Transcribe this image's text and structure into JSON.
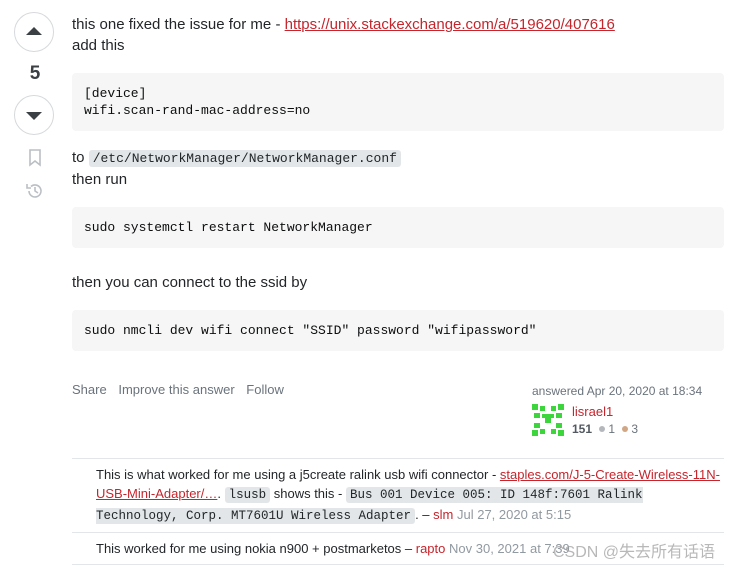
{
  "vote": {
    "score": "5"
  },
  "post": {
    "line1_text": "this one fixed the issue for me - ",
    "line1_link": "https://unix.stackexchange.com/a/519620/407616",
    "line2": "add this",
    "code1": "[device]\nwifi.scan-rand-mac-address=no",
    "to_prefix": "to ",
    "config_path": "/etc/NetworkManager/NetworkManager.conf",
    "then_run": "then run",
    "code2": "sudo systemctl restart NetworkManager",
    "connect_text": "then you can connect to the ssid by",
    "code3": "sudo nmcli dev wifi connect \"SSID\" password \"wifipassword\""
  },
  "menu": {
    "share": "Share",
    "improve": "Improve this answer",
    "follow": "Follow"
  },
  "signature": {
    "answered": "answered Apr 20, 2020 at 18:34",
    "user": "lisrael1",
    "reputation": "151",
    "silver": "1",
    "bronze": "3",
    "silver_color": "#b4b8bc",
    "bronze_color": "#d1a684",
    "avatar_color": "#3cd63c"
  },
  "comments": [
    {
      "text_a": "This is what worked for me using a j5create ralink usb wifi connector - ",
      "link": "staples.com/J-5-Create-Wireless-11N-USB-Mini-Adapter/…",
      "text_b": ". ",
      "code_a": "lsusb",
      "text_c": " shows this - ",
      "code_b": "Bus 001 Device 005: ID 148f:7601 Ralink Technology, Corp. MT7601U Wireless Adapter",
      "text_d": ". – ",
      "user": "slm",
      "date": "Jul 27, 2020 at 5:15"
    },
    {
      "text_a": "This worked for me using nokia n900 + postmarketos – ",
      "user": "rapto",
      "date": "Nov 30, 2021 at 7:39"
    }
  ],
  "watermark": "CSDN @失去所有话语"
}
